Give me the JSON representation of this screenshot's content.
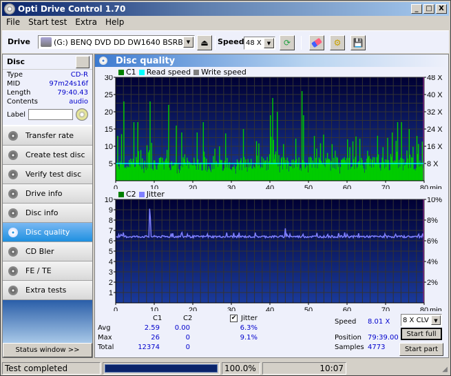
{
  "window": {
    "title": "Opti Drive Control 1.70",
    "minimize": "_",
    "maximize": "□",
    "close": "X"
  },
  "menu": [
    {
      "label": "File"
    },
    {
      "label": "Start test"
    },
    {
      "label": "Extra"
    },
    {
      "label": "Help"
    }
  ],
  "toolbar": {
    "drive_label": "Drive",
    "drive_value": "(G:)  BENQ DVD DD DW1640 BSRB",
    "speed_label": "Speed",
    "speed_value": "48 X",
    "icons": [
      "eject-icon",
      "refresh-icon",
      "erase-icon",
      "settings-icon",
      "save-icon"
    ]
  },
  "disc": {
    "header": "Disc",
    "fields": [
      {
        "label": "Type",
        "value": "CD-R"
      },
      {
        "label": "MID",
        "value": "97m24s16f"
      },
      {
        "label": "Length",
        "value": "79:40.43"
      },
      {
        "label": "Contents",
        "value": "audio"
      }
    ],
    "label_field": "Label",
    "label_value": ""
  },
  "nav": [
    {
      "label": "Transfer rate",
      "active": false
    },
    {
      "label": "Create test disc",
      "active": false
    },
    {
      "label": "Verify test disc",
      "active": false
    },
    {
      "label": "Drive info",
      "active": false
    },
    {
      "label": "Disc info",
      "active": false
    },
    {
      "label": "Disc quality",
      "active": true
    },
    {
      "label": "CD Bler",
      "active": false
    },
    {
      "label": "FE / TE",
      "active": false
    },
    {
      "label": "Extra tests",
      "active": false
    }
  ],
  "status_window_button": "Status window >>",
  "panel_title": "Disc quality",
  "chart_data": [
    {
      "type": "bar",
      "title": "C1 / Read speed",
      "legend": [
        {
          "name": "C1",
          "color": "#008000"
        },
        {
          "name": "Read speed",
          "color": "#00ffff"
        },
        {
          "name": "Write speed",
          "color": "#808080"
        }
      ],
      "xlabel": "min",
      "x_ticks": [
        "0",
        "10",
        "20",
        "30",
        "40",
        "50",
        "60",
        "70",
        "80"
      ],
      "xlim": [
        0,
        80
      ],
      "ylim": [
        0,
        30
      ],
      "y_ticks": [
        "5",
        "10",
        "15",
        "20",
        "25",
        "30"
      ],
      "y2_ticks": [
        "8 X",
        "16 X",
        "24 X",
        "32 X",
        "40 X",
        "48 X"
      ],
      "y2lim": [
        0,
        48
      ],
      "series": [
        {
          "name": "C1",
          "color": "#00cc00",
          "peaks": [
            [
              2,
              23
            ],
            [
              4.5,
              17
            ],
            [
              5.5,
              17
            ],
            [
              8.8,
              23
            ],
            [
              13.5,
              22
            ],
            [
              15.5,
              16
            ],
            [
              17,
              14
            ],
            [
              21,
              14
            ],
            [
              22.5,
              17
            ],
            [
              33,
              15
            ],
            [
              40.5,
              24
            ],
            [
              40,
              19
            ],
            [
              41.7,
              20
            ],
            [
              48.2,
              26
            ],
            [
              48.5,
              19
            ],
            [
              60,
              12
            ],
            [
              71.5,
              14
            ],
            [
              73,
              17
            ],
            [
              74,
              17
            ],
            [
              76,
              15
            ],
            [
              78,
              13
            ]
          ],
          "baseline": 5
        },
        {
          "name": "Read speed",
          "color": "#00ffff",
          "value": 8
        }
      ]
    },
    {
      "type": "line",
      "title": "C2 / Jitter",
      "legend": [
        {
          "name": "C2",
          "color": "#008000"
        },
        {
          "name": "Jitter",
          "color": "#8080ff"
        }
      ],
      "xlabel": "min",
      "x_ticks": [
        "0",
        "10",
        "20",
        "30",
        "40",
        "50",
        "60",
        "70",
        "80"
      ],
      "xlim": [
        0,
        80
      ],
      "ylim": [
        0,
        10
      ],
      "y_ticks": [
        "1",
        "2",
        "3",
        "4",
        "5",
        "6",
        "7",
        "8",
        "9",
        "10"
      ],
      "y2_ticks": [
        "2%",
        "4%",
        "6%",
        "8%",
        "10%"
      ],
      "y2lim": [
        0,
        10
      ],
      "series": [
        {
          "name": "Jitter",
          "color": "#8080ff",
          "baseline": 6.4,
          "peaks": [
            [
              8.7,
              9.1
            ],
            [
              8.9,
              8.2
            ],
            [
              44,
              7.2
            ],
            [
              79.5,
              6.7
            ]
          ]
        },
        {
          "name": "C2",
          "color": "#008000",
          "value": 0
        }
      ]
    }
  ],
  "stats": {
    "col_c1": "C1",
    "col_c2": "C2",
    "jitter_label": "Jitter",
    "jitter_checked": true,
    "rows": [
      {
        "label": "Avg",
        "c1": "2.59",
        "c2": "0.00",
        "jitter": "6.3%"
      },
      {
        "label": "Max",
        "c1": "26",
        "c2": "0",
        "jitter": "9.1%"
      },
      {
        "label": "Total",
        "c1": "12374",
        "c2": "0",
        "jitter": ""
      }
    ]
  },
  "info": {
    "speed_label": "Speed",
    "speed_value": "8.01 X",
    "position_label": "Position",
    "position_value": "79:39.00",
    "samples_label": "Samples",
    "samples_value": "4773",
    "speed_select": "8 X CLV",
    "start_full": "Start full",
    "start_part": "Start part"
  },
  "statusbar": {
    "text": "Test completed",
    "progress": 100.0,
    "progress_text": "100.0%",
    "time": "10:07"
  }
}
